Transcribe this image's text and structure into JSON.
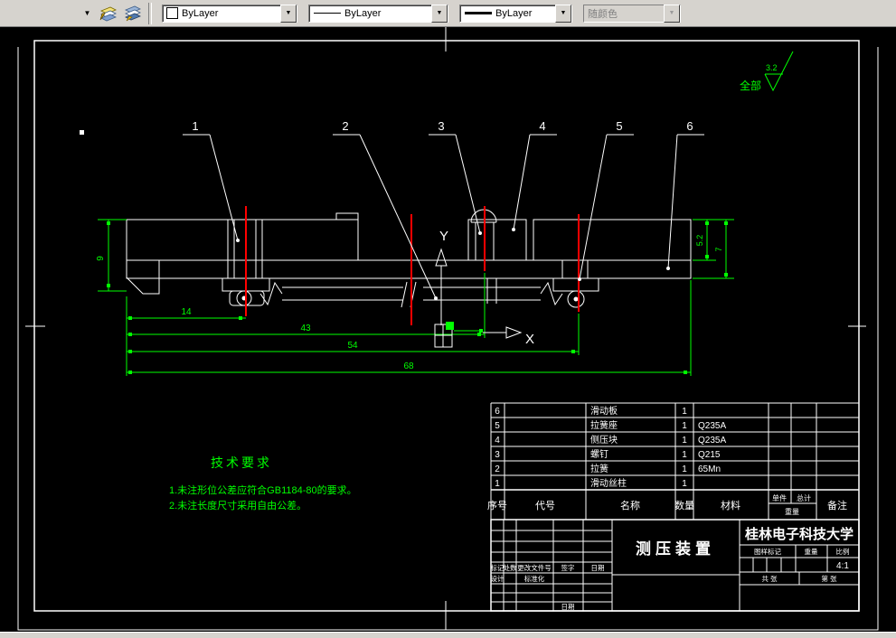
{
  "toolbar": {
    "color_value": "ByLayer",
    "linetype_value": "ByLayer",
    "lineweight_value": "ByLayer",
    "plot_style_value": "随颜色"
  },
  "annotations": {
    "balloons": [
      "1",
      "2",
      "3",
      "4",
      "5",
      "6"
    ],
    "roughness": {
      "scope": "全部",
      "value": "3.2"
    },
    "axes": {
      "x": "X",
      "y": "Y"
    },
    "tech_requirements": {
      "title": "技术要求",
      "item1": "1.未注形位公差应符合GB1184-80的要求。",
      "item2": "2.未注长度尺寸采用自由公差。"
    }
  },
  "dimensions": {
    "height": "9",
    "d14": "14",
    "d43": "43",
    "d54": "54",
    "d68": "68",
    "right_inner": "5.2",
    "right_outer": "7"
  },
  "parts_table": {
    "headers": {
      "no": "序号",
      "code": "代号",
      "name": "名称",
      "qty": "数量",
      "material": "材料",
      "unit": "单件",
      "total": "总计",
      "weight": "重量",
      "remark": "备注"
    },
    "rows": [
      {
        "no": "6",
        "code": "",
        "name": "滑动板",
        "qty": "1",
        "material": "",
        "remark": ""
      },
      {
        "no": "5",
        "code": "",
        "name": "拉簧座",
        "qty": "1",
        "material": "Q235A",
        "remark": ""
      },
      {
        "no": "4",
        "code": "",
        "name": "侧压块",
        "qty": "1",
        "material": "Q235A",
        "remark": ""
      },
      {
        "no": "3",
        "code": "",
        "name": "螺钉",
        "qty": "1",
        "material": "Q215",
        "remark": ""
      },
      {
        "no": "2",
        "code": "",
        "name": "拉簧",
        "qty": "1",
        "material": "65Mn",
        "remark": ""
      },
      {
        "no": "1",
        "code": "",
        "name": "滑动丝柱",
        "qty": "1",
        "material": "",
        "remark": ""
      }
    ]
  },
  "title_block": {
    "drawing_title": "测压装置",
    "organization": "桂林电子科技大学",
    "mark_header": "图样标记",
    "weight_header": "重量",
    "scale_header": "比例",
    "scale_value": "4:1",
    "sheets_total": "共 张",
    "sheet_number": "第 张",
    "revision_row": {
      "mark": "标记",
      "count": "处数",
      "doc_no": "更改文件号",
      "sign": "签字",
      "date": "日期"
    },
    "design_label": "设计",
    "standard_label": "标准化",
    "date_label": "日期"
  },
  "colors": {
    "hatch": "#00e0e0",
    "dimension": "#00ff00",
    "section_cut": "#ff0000",
    "paper_line": "#ffffff",
    "background": "#000000",
    "toolbar_bg": "#d6d3ce"
  }
}
